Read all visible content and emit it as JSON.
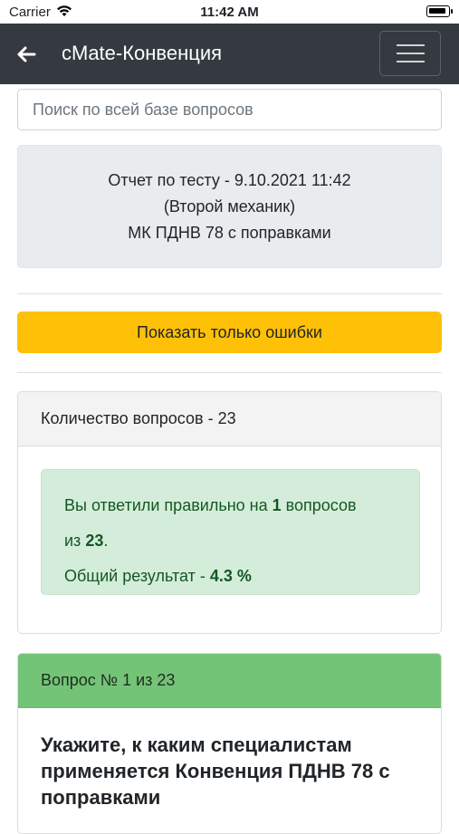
{
  "status": {
    "carrier": "Carrier",
    "time": "11:42 AM"
  },
  "navbar": {
    "title": "cMate-Конвенция"
  },
  "search": {
    "placeholder": "Поиск по всей базе вопросов"
  },
  "report": {
    "line1": "Отчет по тесту - 9.10.2021 11:42",
    "line2": "(Второй механик)",
    "line3": "МК ПДНВ 78 с поправками"
  },
  "errors_button": {
    "label": "Показать только ошибки"
  },
  "summary": {
    "header": "Количество вопросов - 23",
    "answered_prefix": "Вы ответили правильно на ",
    "correct": "1",
    "answered_suffix": " вопросов",
    "of_prefix": "из ",
    "total": "23",
    "of_suffix": ".",
    "result_prefix": "Общий результат - ",
    "result": "4.3 %"
  },
  "question": {
    "header": "Вопрос № 1 из 23",
    "text": "Укажите, к каким специалистам применяется Конвенция ПДНВ 78 с поправками"
  },
  "colors": {
    "navbar": "#343a40",
    "warning": "#ffc107",
    "success_bg": "#d4edda",
    "success_text": "#155724",
    "question_header": "#74c477"
  }
}
